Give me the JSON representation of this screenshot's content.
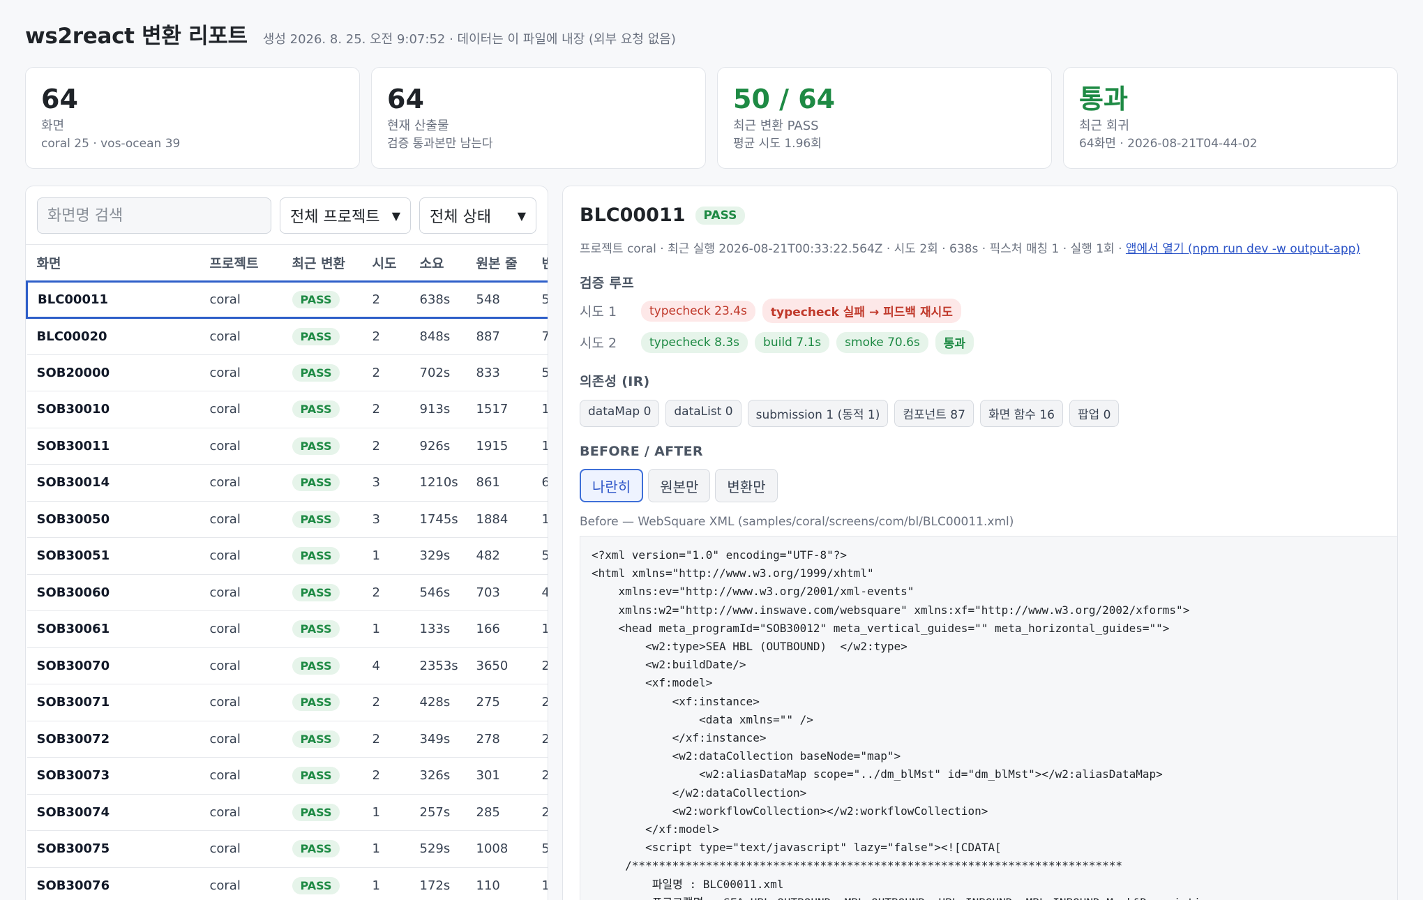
{
  "header": {
    "title": "ws2react 변환 리포트",
    "subtitle": "생성 2026. 8. 25. 오전 9:07:52 · 데이터는 이 파일에 내장 (외부 요청 없음)"
  },
  "cards": [
    {
      "big": "64",
      "label": "화면",
      "sub": "coral 25 · vos-ocean 39"
    },
    {
      "big": "64",
      "label": "현재 산출물",
      "sub": "검증 통과본만 남는다"
    },
    {
      "big": "50 / 64",
      "label": "최근 변환 PASS",
      "sub": "평균 시도 1.96회"
    },
    {
      "big": "통과",
      "label": "최근 회귀",
      "sub": "64화면 · 2026-08-21T04-44-02"
    }
  ],
  "filters": {
    "search_placeholder": "화면명 검색",
    "project_select": "전체 프로젝트",
    "status_select": "전체 상태"
  },
  "table": {
    "headers": [
      "화면",
      "프로젝트",
      "최근 변환",
      "시도",
      "소요",
      "원본 줄",
      "변"
    ],
    "rows": [
      {
        "screen": "BLC00011",
        "project": "coral",
        "status": "PASS",
        "attempts": "2",
        "time": "638s",
        "lines": "548",
        "extra": "5"
      },
      {
        "screen": "BLC00020",
        "project": "coral",
        "status": "PASS",
        "attempts": "2",
        "time": "848s",
        "lines": "887",
        "extra": "7"
      },
      {
        "screen": "SOB20000",
        "project": "coral",
        "status": "PASS",
        "attempts": "2",
        "time": "702s",
        "lines": "833",
        "extra": "5"
      },
      {
        "screen": "SOB30010",
        "project": "coral",
        "status": "PASS",
        "attempts": "2",
        "time": "913s",
        "lines": "1517",
        "extra": "1"
      },
      {
        "screen": "SOB30011",
        "project": "coral",
        "status": "PASS",
        "attempts": "2",
        "time": "926s",
        "lines": "1915",
        "extra": "1"
      },
      {
        "screen": "SOB30014",
        "project": "coral",
        "status": "PASS",
        "attempts": "3",
        "time": "1210s",
        "lines": "861",
        "extra": "6"
      },
      {
        "screen": "SOB30050",
        "project": "coral",
        "status": "PASS",
        "attempts": "3",
        "time": "1745s",
        "lines": "1884",
        "extra": "1"
      },
      {
        "screen": "SOB30051",
        "project": "coral",
        "status": "PASS",
        "attempts": "1",
        "time": "329s",
        "lines": "482",
        "extra": "5"
      },
      {
        "screen": "SOB30060",
        "project": "coral",
        "status": "PASS",
        "attempts": "2",
        "time": "546s",
        "lines": "703",
        "extra": "4"
      },
      {
        "screen": "SOB30061",
        "project": "coral",
        "status": "PASS",
        "attempts": "1",
        "time": "133s",
        "lines": "166",
        "extra": "1"
      },
      {
        "screen": "SOB30070",
        "project": "coral",
        "status": "PASS",
        "attempts": "4",
        "time": "2353s",
        "lines": "3650",
        "extra": "2"
      },
      {
        "screen": "SOB30071",
        "project": "coral",
        "status": "PASS",
        "attempts": "2",
        "time": "428s",
        "lines": "275",
        "extra": "2"
      },
      {
        "screen": "SOB30072",
        "project": "coral",
        "status": "PASS",
        "attempts": "2",
        "time": "349s",
        "lines": "278",
        "extra": "2"
      },
      {
        "screen": "SOB30073",
        "project": "coral",
        "status": "PASS",
        "attempts": "2",
        "time": "326s",
        "lines": "301",
        "extra": "2"
      },
      {
        "screen": "SOB30074",
        "project": "coral",
        "status": "PASS",
        "attempts": "1",
        "time": "257s",
        "lines": "285",
        "extra": "2"
      },
      {
        "screen": "SOB30075",
        "project": "coral",
        "status": "PASS",
        "attempts": "1",
        "time": "529s",
        "lines": "1008",
        "extra": "5"
      },
      {
        "screen": "SOB30076",
        "project": "coral",
        "status": "PASS",
        "attempts": "1",
        "time": "172s",
        "lines": "110",
        "extra": "1"
      }
    ]
  },
  "detail": {
    "title": "BLC00011",
    "status": "PASS",
    "meta": "프로젝트 coral · 최근 실행 2026-08-21T00:33:22.564Z · 시도 2회 · 638s · 픽스처 매칭 1 · 실행 1회 · ",
    "meta_link": "앱에서 열기 (npm run dev -w output-app)",
    "loop_title": "검증 루프",
    "attempts": [
      {
        "label": "시도 1",
        "chips": [
          {
            "text": "typecheck 23.4s",
            "kind": "red"
          },
          {
            "text": "typecheck 실패 → 피드백 재시도",
            "kind": "redb"
          }
        ]
      },
      {
        "label": "시도 2",
        "chips": [
          {
            "text": "typecheck 8.3s",
            "kind": "green"
          },
          {
            "text": "build 7.1s",
            "kind": "green"
          },
          {
            "text": "smoke 70.6s",
            "kind": "green"
          },
          {
            "text": "통과",
            "kind": "greenb"
          }
        ]
      }
    ],
    "deps_title": "의존성 (IR)",
    "deps": [
      "dataMap 0",
      "dataList 0",
      "submission 1 (동적 1)",
      "컴포넌트 87",
      "화면 함수 16",
      "팝업 0"
    ],
    "ba_title": "BEFORE / AFTER",
    "views": [
      "나란히",
      "원본만",
      "변환만"
    ],
    "before_label": "Before — WebSquare XML (samples/coral/screens/com/bl/BLC00011.xml)",
    "code": "<?xml version=\"1.0\" encoding=\"UTF-8\"?>\n<html xmlns=\"http://www.w3.org/1999/xhtml\"\n    xmlns:ev=\"http://www.w3.org/2001/xml-events\"\n    xmlns:w2=\"http://www.inswave.com/websquare\" xmlns:xf=\"http://www.w3.org/2002/xforms\">\n    <head meta_programId=\"SOB30012\" meta_vertical_guides=\"\" meta_horizontal_guides=\"\">\n        <w2:type>SEA HBL (OUTBOUND)  </w2:type>\n        <w2:buildDate/>\n        <xf:model>\n            <xf:instance>\n                <data xmlns=\"\" />\n            </xf:instance>\n            <w2:dataCollection baseNode=\"map\">\n                <w2:aliasDataMap scope=\"../dm_blMst\" id=\"dm_blMst\"></w2:aliasDataMap>\n            </w2:dataCollection>\n            <w2:workflowCollection></w2:workflowCollection>\n        </xf:model>\n        <script type=\"text/javascript\" lazy=\"false\"><![CDATA[\n     /*************************************************************************\n         파일명 : BLC00011.xml\n         프로그램명 : SEA HBL OUTBOUND, MBL OUTBOUND, HBL INBOUND, MBL INBOUND Mark&Description\n         설 명 : SEA HBL OUTBOUND, MBL OUTBOUND, HBL INBOUND, MBL INBOUND Mark&Description"
  }
}
